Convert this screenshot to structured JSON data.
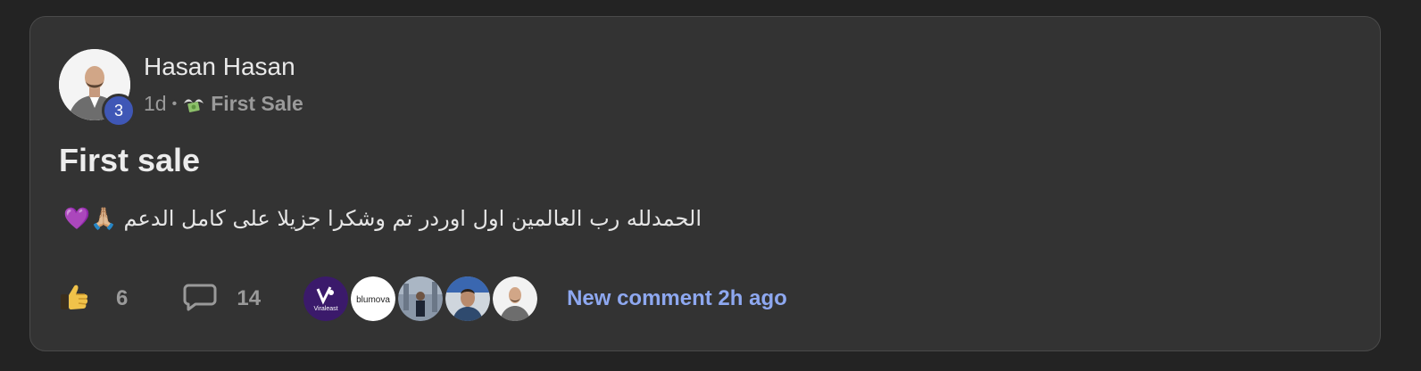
{
  "post": {
    "author": "Hasan Hasan",
    "level": "3",
    "time": "1d",
    "separator": "•",
    "category": "First Sale",
    "category_icon": "money-with-wings-icon",
    "title": "First sale",
    "body": "الحمدلله رب العالمين اول اوردر تم وشكرا جزيلا على كامل الدعم 🙏🏼💜"
  },
  "footer": {
    "likes": "6",
    "comments": "14",
    "new_comment": "New comment 2h ago",
    "commenters": [
      {
        "label": "Viraleast",
        "kind": "logo-purple"
      },
      {
        "label": "blumova",
        "kind": "logo-white"
      },
      {
        "label": "",
        "kind": "photo"
      },
      {
        "label": "",
        "kind": "photo"
      },
      {
        "label": "",
        "kind": "photo"
      }
    ]
  },
  "colors": {
    "page_bg": "#232323",
    "card_bg": "#333333",
    "badge": "#3f57b6",
    "link": "#8ea8f0",
    "muted": "#9a9a9a"
  }
}
